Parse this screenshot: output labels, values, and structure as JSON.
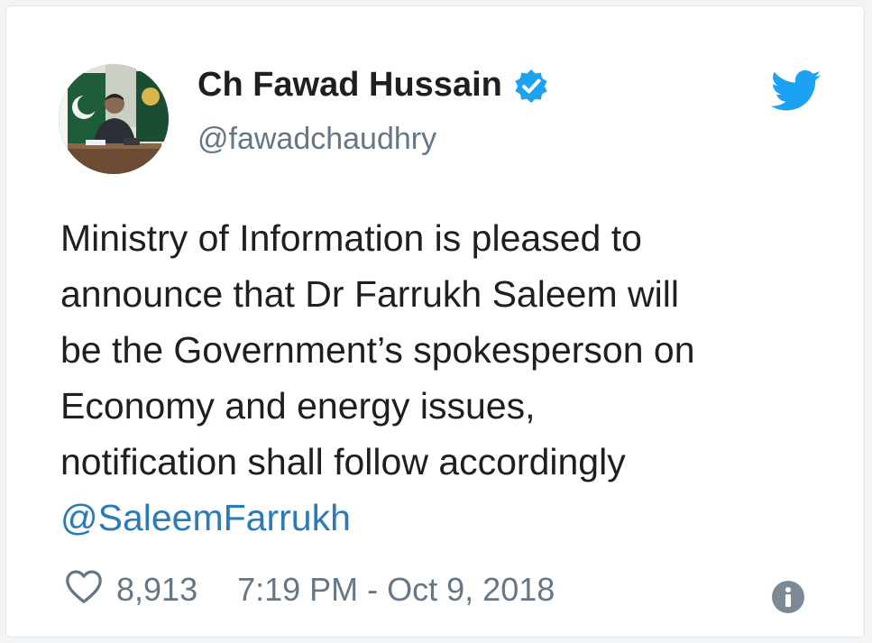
{
  "tweet": {
    "display_name": "Ch Fawad Hussain",
    "handle": "@fawadchaudhry",
    "text_lines": [
      "Ministry of Information is pleased to",
      "announce that Dr Farrukh Saleem will",
      "be the Government’s spokesperson on",
      "Economy and energy issues,",
      "notification shall follow accordingly"
    ],
    "mention": "@SaleemFarrukh",
    "likes": "8,913",
    "timestamp": "7:19 PM - Oct 9, 2018",
    "verified": true
  },
  "icons": {
    "verified": "verified-badge-icon",
    "brand": "twitter-bird-icon",
    "like": "heart-icon",
    "info": "info-icon"
  },
  "colors": {
    "brand_blue": "#1da1f2",
    "link_blue": "#2b7bb9",
    "text_dark": "#1c2022",
    "text_gray": "#657786"
  }
}
